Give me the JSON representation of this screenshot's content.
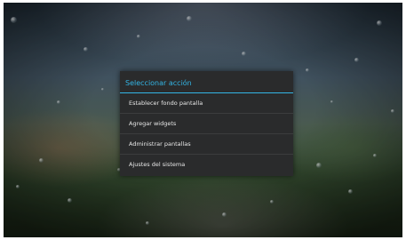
{
  "dialog": {
    "title": "Seleccionar acción",
    "items": [
      {
        "label": "Establecer fondo pantalla"
      },
      {
        "label": "Agregar widgets"
      },
      {
        "label": "Administrar pantallas"
      },
      {
        "label": "Ajustes del sistema"
      }
    ]
  },
  "colors": {
    "accent": "#33b5e5",
    "dialog_background": "#2a2b2c",
    "item_text": "#e8e8e8",
    "divider": "#3c3d3e"
  }
}
